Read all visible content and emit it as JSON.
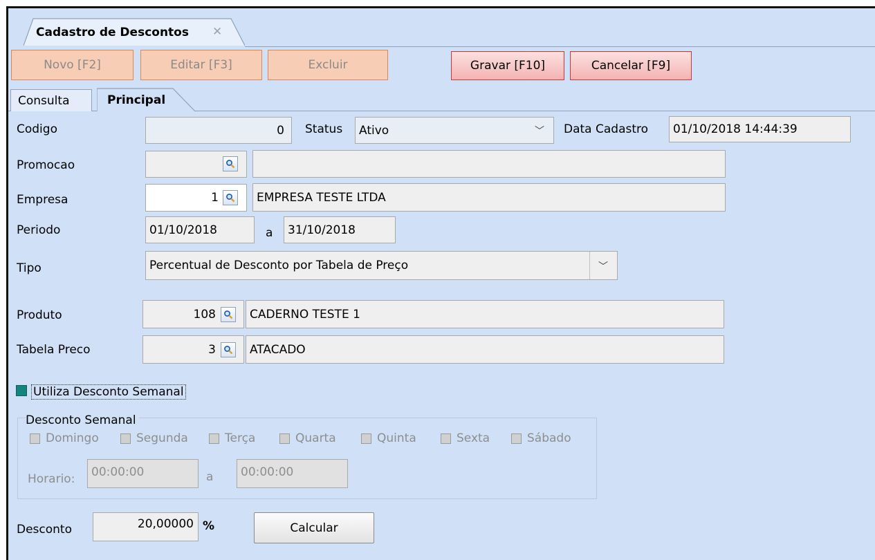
{
  "window": {
    "tab_title": "Cadastro de Descontos",
    "close_glyph": "✕"
  },
  "toolbar": {
    "novo": "Novo [F2]",
    "editar": "Editar [F3]",
    "excluir": "Excluir",
    "gravar": "Gravar [F10]",
    "cancelar": "Cancelar [F9]"
  },
  "page_tabs": {
    "consulta": "Consulta",
    "principal": "Principal"
  },
  "form": {
    "codigo_label": "Codigo",
    "codigo_value": "0",
    "status_label": "Status",
    "status_value": "Ativo",
    "data_cadastro_label": "Data Cadastro",
    "data_cadastro_value": "01/10/2018 14:44:39",
    "promocao_label": "Promocao",
    "promocao_code": "",
    "promocao_desc": "",
    "empresa_label": "Empresa",
    "empresa_code": "1",
    "empresa_desc": "EMPRESA TESTE LTDA",
    "periodo_label": "Periodo",
    "periodo_start": "01/10/2018",
    "periodo_sep": "a",
    "periodo_end": "31/10/2018",
    "tipo_label": "Tipo",
    "tipo_value": "Percentual de Desconto por Tabela de Preço",
    "produto_label": "Produto",
    "produto_code": "108",
    "produto_desc": "CADERNO TESTE 1",
    "tabela_label": "Tabela Preco",
    "tabela_code": "3",
    "tabela_desc": "ATACADO",
    "utiliza_semanal_label": "Utiliza Desconto Semanal",
    "utiliza_semanal_checked": true
  },
  "desconto_semanal": {
    "title": "Desconto Semanal",
    "days": [
      "Domingo",
      "Segunda",
      "Terça",
      "Quarta",
      "Quinta",
      "Sexta",
      "Sábado"
    ],
    "horario_label": "Horario:",
    "horario_start": "00:00:00",
    "horario_sep": "a",
    "horario_end": "00:00:00"
  },
  "desconto": {
    "label": "Desconto",
    "value": "20,00000",
    "unit": "%",
    "calcular": "Calcular"
  },
  "colors": {
    "background": "#cfe0f7",
    "toolbar_disabled_fill": "#f8cdb6",
    "toolbar_active_fill": "#f4b3b3",
    "checkbox_checked": "#138580"
  },
  "icons": {
    "lookup": "magnifier-icon",
    "dropdown": "chevron-down-icon",
    "close": "close-icon"
  }
}
